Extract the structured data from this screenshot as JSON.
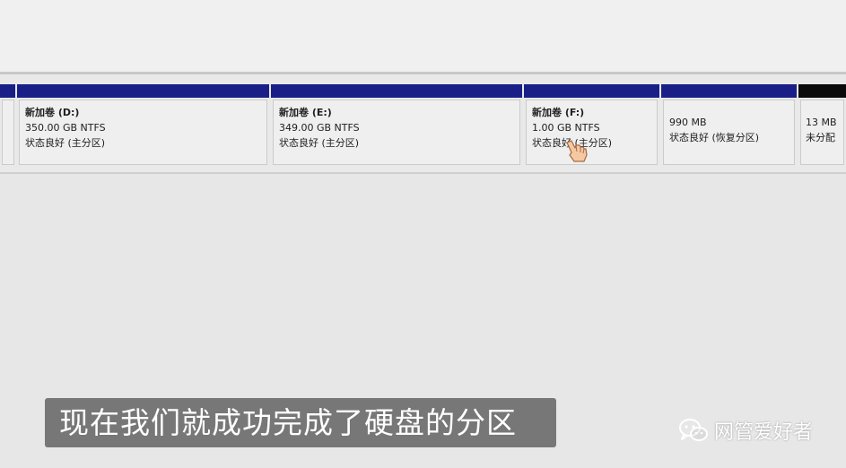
{
  "partitions": [
    {
      "name": "新加卷 (D:)",
      "size": "350.00 GB NTFS",
      "status": "状态良好 (主分区)"
    },
    {
      "name": "新加卷 (E:)",
      "size": "349.00 GB NTFS",
      "status": "状态良好 (主分区)"
    },
    {
      "name": "新加卷 (F:)",
      "size": "1.00 GB NTFS",
      "status": "状态良好 (主分区)"
    },
    {
      "name": "",
      "size": "990 MB",
      "status": "状态良好 (恢复分区)"
    },
    {
      "name": "",
      "size": "13 MB",
      "status": "未分配"
    }
  ],
  "subtitle": "现在我们就成功完成了硬盘的分区",
  "watermark": {
    "text": "网管爱好者",
    "icon": "wechat-icon"
  },
  "colors": {
    "primary_partition_bar": "#1a1f88",
    "unallocated_bar": "#0b0b0b",
    "subtitle_background": "#6e6e6e"
  }
}
